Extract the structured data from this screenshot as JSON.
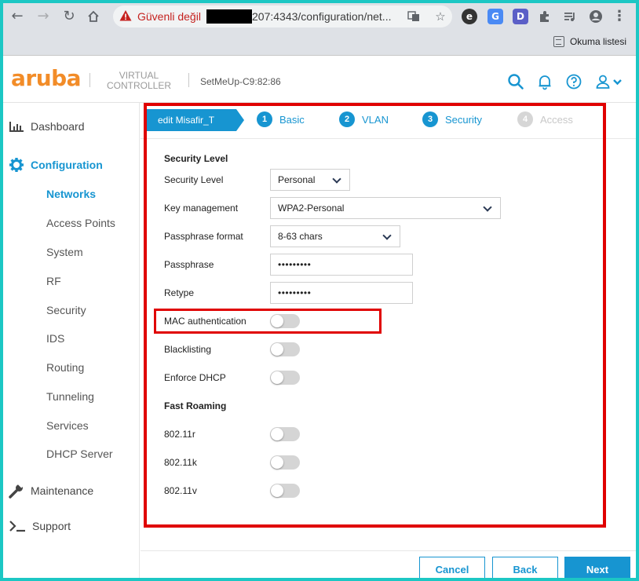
{
  "browser": {
    "insecure_label": "Güvenli değil",
    "url": "207:4343/configuration/net...",
    "reading_list_label": "Okuma listesi"
  },
  "header": {
    "logo_text": "aruba",
    "product_line1": "VIRTUAL",
    "product_line2": "CONTROLLER",
    "device_name": "SetMeUp-C9:82:86"
  },
  "sidebar": {
    "dashboard": "Dashboard",
    "configuration": "Configuration",
    "sub_items": [
      "Networks",
      "Access Points",
      "System",
      "RF",
      "Security",
      "IDS",
      "Routing",
      "Tunneling",
      "Services",
      "DHCP Server"
    ],
    "maintenance": "Maintenance",
    "support": "Support"
  },
  "wizard": {
    "edit_tab": "edit Misafir_T",
    "steps": [
      {
        "num": "1",
        "label": "Basic"
      },
      {
        "num": "2",
        "label": "VLAN"
      },
      {
        "num": "3",
        "label": "Security"
      },
      {
        "num": "4",
        "label": "Access"
      }
    ]
  },
  "form": {
    "security_level_title": "Security Level",
    "security_level_label": "Security Level",
    "security_level_value": "Personal",
    "key_mgmt_label": "Key management",
    "key_mgmt_value": "WPA2-Personal",
    "pass_format_label": "Passphrase format",
    "pass_format_value": "8-63 chars",
    "passphrase_label": "Passphrase",
    "passphrase_value": "•••••••••",
    "retype_label": "Retype",
    "retype_value": "•••••••••",
    "mac_auth_label": "MAC authentication",
    "blacklisting_label": "Blacklisting",
    "enforce_dhcp_label": "Enforce DHCP",
    "fast_roaming_title": "Fast Roaming",
    "r_label": "802.11r",
    "k_label": "802.11k",
    "v_label": "802.11v"
  },
  "footer": {
    "cancel": "Cancel",
    "back": "Back",
    "next": "Next"
  },
  "colors": {
    "accent": "#1795d1",
    "brand": "#f28c28",
    "highlight": "#e00000"
  }
}
